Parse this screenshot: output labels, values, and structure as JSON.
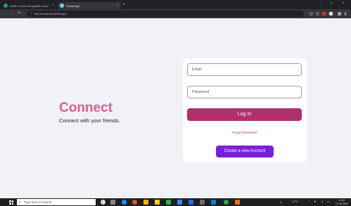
{
  "browser": {
    "tabs": [
      {
        "title": "Debit | Cloud: MongoDB Cloud",
        "icon": "mongodb-leaf-icon",
        "color": "#13aa52"
      },
      {
        "title": "Social App",
        "icon": "react-icon",
        "color": "#61dafb"
      }
    ],
    "new_tab": "+",
    "url": "http://localhost:3000/login"
  },
  "page": {
    "brand_title": "Connect",
    "brand_subtitle": "Connect with your friends.",
    "login": {
      "email_placeholder": "Email",
      "password_placeholder": "Password",
      "login_button": "Log In",
      "forgot_password": "Forgot Password?",
      "create_account_button": "Create a new Account"
    },
    "colors": {
      "brand": "#db5f96",
      "login_button": "#b0306a",
      "create_button": "#7b1fd8"
    }
  },
  "taskbar": {
    "search_placeholder": "Type here to search",
    "temperature": "17°C",
    "clock_time": "10:40",
    "clock_date": "17-09-2022"
  }
}
